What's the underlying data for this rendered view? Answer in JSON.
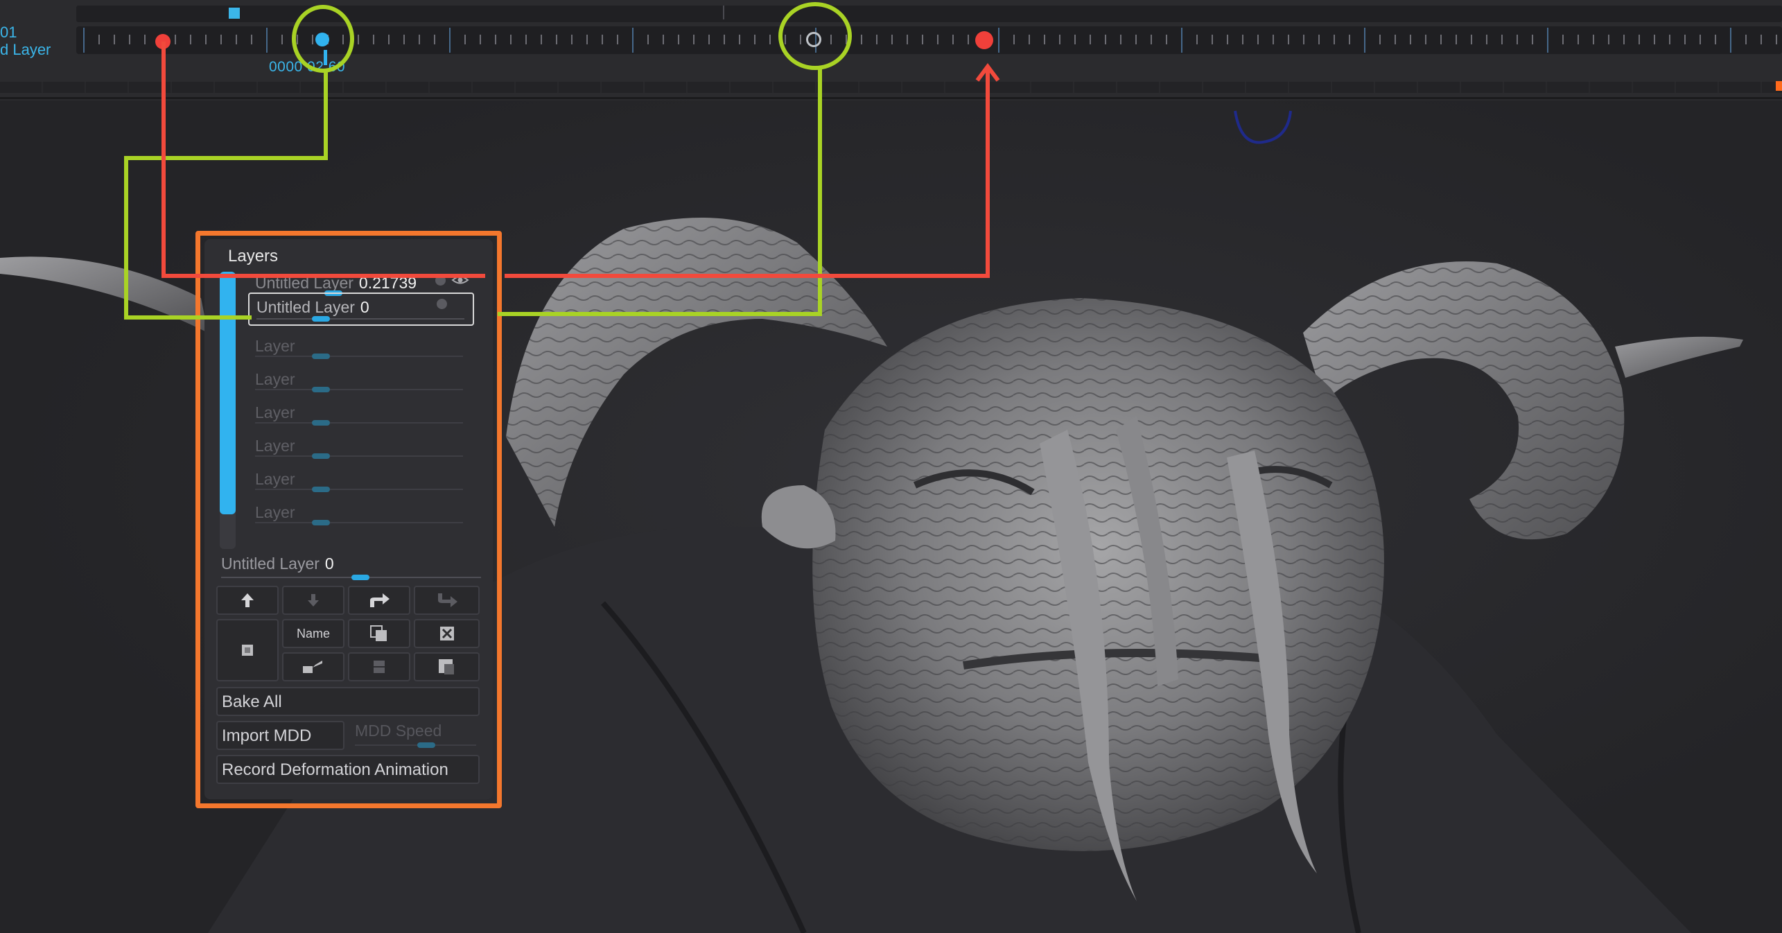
{
  "timeline": {
    "left_label_top": "01",
    "left_label_bottom": "d Layer",
    "time_readout": "0000 02:60"
  },
  "layers_panel": {
    "title": "Layers",
    "layers": [
      {
        "name": "Untitled Layer",
        "value": "0.21739",
        "slider": 0.33,
        "state": "active"
      },
      {
        "name": "Untitled Layer",
        "value": "0",
        "slider": 0.27,
        "state": "selected"
      },
      {
        "name": "Layer",
        "value": "",
        "slider": 0.27,
        "state": "empty"
      },
      {
        "name": "Layer",
        "value": "",
        "slider": 0.27,
        "state": "empty"
      },
      {
        "name": "Layer",
        "value": "",
        "slider": 0.27,
        "state": "empty"
      },
      {
        "name": "Layer",
        "value": "",
        "slider": 0.27,
        "state": "empty"
      },
      {
        "name": "Layer",
        "value": "",
        "slider": 0.27,
        "state": "empty"
      },
      {
        "name": "Layer",
        "value": "",
        "slider": 0.27,
        "state": "empty"
      }
    ],
    "global_layer": {
      "name": "Untitled Layer",
      "value": "0"
    },
    "buttons": {
      "move_up_icon": "arrow-up-icon",
      "move_down_icon": "arrow-down-icon",
      "split_icon": "split-arrow-icon",
      "merge_icon": "merge-arrow-icon",
      "name_label": "Name"
    },
    "bake_all": "Bake All",
    "import_mdd": "Import MDD",
    "mdd_speed": "MDD Speed",
    "record_deformation": "Record Deformation Animation"
  },
  "colors": {
    "accent_blue": "#31b3ef",
    "annotation_red": "#f24a3c",
    "annotation_green": "#a9d325",
    "panel_frame_orange": "#f4772d"
  }
}
